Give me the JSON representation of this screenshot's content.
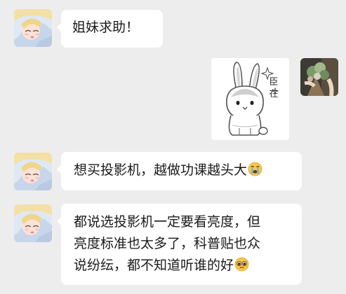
{
  "chat": {
    "messages": [
      {
        "sender": "friend",
        "type": "text",
        "text": "姐妹求助！",
        "emoji": ""
      },
      {
        "sender": "me",
        "type": "sticker",
        "sticker_text": [
          "臣",
          "在"
        ],
        "sticker_icon": "bunny-sticker-icon"
      },
      {
        "sender": "friend",
        "type": "text",
        "text": "想买投影机，越做功课越头大",
        "emoji": "crying-emoji"
      },
      {
        "sender": "friend",
        "type": "text",
        "text": "都说选投影机一定要看亮度，但\n亮度标准也太多了，科普贴也众\n说纷纭，都不知道听谁的好",
        "emoji": "pleading-emoji"
      }
    ]
  },
  "colors": {
    "background": "#ededed",
    "bubble": "#ffffff",
    "text": "#1a1a1a"
  }
}
